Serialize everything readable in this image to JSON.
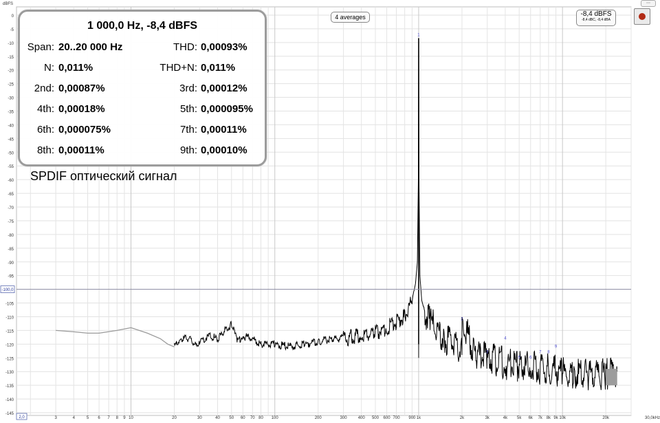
{
  "chart_data": {
    "type": "line",
    "ylabel": "dBFS",
    "xlabel": "30,0kHz",
    "x_scale": "log",
    "xlim": [
      1.6,
      30000
    ],
    "ylim": [
      -146,
      3
    ],
    "y_ticks": [
      0,
      -5,
      -10,
      -15,
      -20,
      -25,
      -30,
      -35,
      -40,
      -45,
      -50,
      -55,
      -60,
      -65,
      -70,
      -75,
      -80,
      -85,
      -90,
      -95,
      -105,
      -110,
      -115,
      -120,
      -125,
      -130,
      -135,
      -140,
      -145
    ],
    "y_tick_labels": [
      "0",
      "-5",
      "-10",
      "-15",
      "-20",
      "-25",
      "-30",
      "-35",
      "-40",
      "-45",
      "-50",
      "-55",
      "-60",
      "-65",
      "-70",
      "-75",
      "-80",
      "-85",
      "-90",
      "-95",
      "-105",
      "-110",
      "-115",
      "-120",
      "-125",
      "-130",
      "-135",
      "-140",
      "-145"
    ],
    "x_ticks": [
      3,
      4,
      5,
      6,
      7,
      8,
      9,
      10,
      20,
      30,
      40,
      50,
      60,
      70,
      80,
      100,
      200,
      300,
      400,
      500,
      600,
      700,
      900,
      1000,
      2000,
      3000,
      4000,
      5000,
      6000,
      7000,
      8000,
      9000,
      10000,
      20000
    ],
    "x_tick_labels": [
      "3",
      "4",
      "5",
      "6",
      "7",
      "8",
      "9",
      "10",
      "20",
      "30",
      "40",
      "50",
      "60",
      "70",
      "80",
      "100",
      "200",
      "300",
      "400",
      "500",
      "600",
      "700",
      "900",
      "1k",
      "2k",
      "3k",
      "4k",
      "5k",
      "6k",
      "7k",
      "8k",
      "9k",
      "10k",
      "20k"
    ],
    "cursor_y_label": "-100,0",
    "cursor_x_label": "2,0",
    "averages_label": "4 averages",
    "level_main": "-8,4 dBFS",
    "level_sub": "-8,4 dBC, -8,4 dBA",
    "series": [
      {
        "x": [
          3,
          4,
          5,
          6,
          8,
          10,
          13,
          16,
          18,
          20,
          22,
          25,
          28,
          30,
          35,
          40,
          45,
          50,
          55,
          60,
          70,
          80,
          100,
          130,
          160,
          200,
          250,
          300,
          400,
          500,
          600,
          700,
          800,
          900,
          950,
          980,
          995,
          1000,
          1005,
          1020,
          1050,
          1100,
          1200,
          1500,
          2000,
          2001,
          2500,
          3000,
          4000,
          5000,
          6000,
          7000,
          8000,
          10000,
          12000,
          15000,
          20000,
          24000
        ],
        "y": [
          -115,
          -115.5,
          -116,
          -116,
          -115,
          -114,
          -116,
          -118,
          -120,
          -121,
          -118,
          -118,
          -120,
          -119,
          -117,
          -118,
          -115,
          -113,
          -119,
          -117,
          -118,
          -120,
          -120,
          -121,
          -120,
          -119,
          -118,
          -118,
          -117,
          -116,
          -114,
          -112,
          -110,
          -104,
          -98,
          -90,
          -60,
          -8.4,
          -60,
          -95,
          -104,
          -108,
          -112,
          -118,
          -122,
          -112,
          -124,
          -125,
          -127,
          -128,
          -128,
          -129,
          -129,
          -130,
          -131,
          -131,
          -131,
          -130
        ]
      }
    ],
    "peak_markers": [
      {
        "label": "1",
        "x": 1000,
        "y": -8.4
      },
      {
        "label": "2",
        "x": 2000,
        "y": -112
      },
      {
        "label": "3",
        "x": 3000,
        "y": -124
      },
      {
        "label": "4",
        "x": 4000,
        "y": -119
      },
      {
        "label": "5",
        "x": 5000,
        "y": -126
      },
      {
        "label": "6",
        "x": 6000,
        "y": -126
      },
      {
        "label": "7",
        "x": 7000,
        "y": -124
      },
      {
        "label": "8",
        "x": 8000,
        "y": -124
      },
      {
        "label": "9",
        "x": 9000,
        "y": -122
      }
    ],
    "grid": true
  },
  "panel": {
    "title": "1 000,0 Hz, -8,4 dBFS",
    "rows": [
      {
        "l1": "Span:",
        "v1": "20..20 000 Hz",
        "l2": "THD:",
        "v2": "0,00093%"
      },
      {
        "l1": "N:",
        "v1": "0,011%",
        "l2": "THD+N:",
        "v2": "0,011%"
      },
      {
        "l1": "2nd:",
        "v1": "0,00087%",
        "l2": "3rd:",
        "v2": "0,00012%"
      },
      {
        "l1": "4th:",
        "v1": "0,00018%",
        "l2": "5th:",
        "v2": "0,000095%"
      },
      {
        "l1": "6th:",
        "v1": "0,000075%",
        "l2": "7th:",
        "v2": "0,00011%"
      },
      {
        "l1": "8th:",
        "v1": "0,00011%",
        "l2": "9th:",
        "v2": "0,00010%"
      }
    ]
  },
  "overlay_text": "SPDIF оптический сигнал"
}
